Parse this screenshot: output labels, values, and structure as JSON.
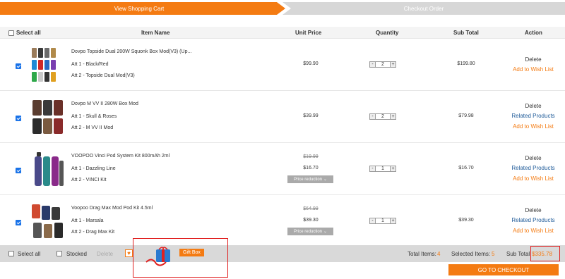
{
  "steps": {
    "step1": "View Shopping Cart",
    "step2": "Checkout Order"
  },
  "header": {
    "select_all": "Select all",
    "item_name": "Item Name",
    "unit_price": "Unit Price",
    "quantity": "Quantity",
    "sub_total": "Sub Total",
    "action": "Action"
  },
  "items": [
    {
      "name": "Dovpo Topside Dual 200W Squonk Box Mod(V3) (Up...",
      "att1": "Att 1 - Black/Red",
      "att2": "Att 2 - Topside Dual Mod(V3)",
      "old_price": "",
      "price": "$99.90",
      "price_reduction": "",
      "qty": "2",
      "subtotal": "$199.80",
      "actions": [
        "Delete",
        "Add to Wish List"
      ],
      "checked": true
    },
    {
      "name": "Dovpo M VV II 280W Box Mod",
      "att1": "Att 1 - Skull & Roses",
      "att2": "Att 2 - M VV II Mod",
      "old_price": "",
      "price": "$39.99",
      "price_reduction": "",
      "qty": "2",
      "subtotal": "$79.98",
      "actions": [
        "Delete",
        "Related Products",
        "Add to Wish List"
      ],
      "checked": true
    },
    {
      "name": "VOOPOO Vinci Pod System Kit 800mAh 2ml",
      "att1": "Att 1 - Dazzling Line",
      "att2": "Att 2 - VINCI Kit",
      "old_price": "$19.99",
      "price": "$16.70",
      "price_reduction": "Price reduction",
      "qty": "1",
      "subtotal": "$16.70",
      "actions": [
        "Delete",
        "Related Products",
        "Add to Wish List"
      ],
      "checked": true
    },
    {
      "name": "Voopoo Drag Max Mod Pod Kit 4.5ml",
      "att1": "Att 1 - Marsala",
      "att2": "Att 2 - Drag Max Kit",
      "old_price": "$64.99",
      "price": "$39.30",
      "price_reduction": "Price reduction",
      "qty": "1",
      "subtotal": "$39.30",
      "actions": [
        "Delete",
        "Related Products",
        "Add to Wish List"
      ],
      "checked": true
    }
  ],
  "qty_controls": {
    "minus": "-",
    "plus": "+"
  },
  "footer": {
    "select_all": "Select all",
    "stocked": "Stocked",
    "delete": "Delete",
    "heart_icon": "heart-icon",
    "gift_box": "Gift Box",
    "total_items_label": "Total Items:",
    "total_items": "4",
    "selected_items_label": "Selected Items:",
    "selected_items": "5",
    "sub_total_label": "Sub Total:",
    "sub_total": "$335.78",
    "checkout": "GO TO CHECKOUT"
  },
  "colors": {
    "accent": "#f47b12",
    "link": "#1f5b99",
    "highlight_box": "#e02020"
  }
}
